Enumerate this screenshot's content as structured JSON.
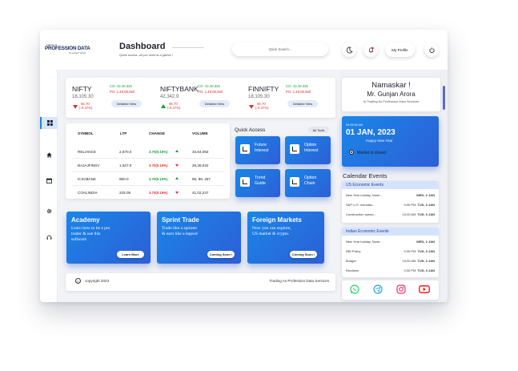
{
  "brand": {
    "logo_small": "trading as",
    "logo_main": "PROFESSION DATA",
    "logo_tag": "we analyze stocks"
  },
  "header": {
    "title": "Dashboard",
    "subtitle": "Quick access, all you need at a glance !",
    "search_placeholder": "Quick Search...",
    "profile_label": "My Profile"
  },
  "indices": [
    {
      "name": "NIFTY",
      "price": "18,105.30",
      "change": "65.70",
      "pct": "(-0.47%)",
      "co": "CO: 42,49,325",
      "po": "PO: 1,49,09,650",
      "direction": "down",
      "view": "Detailed View"
    },
    {
      "name": "NIFTYBANK",
      "price": "42,342.9",
      "change": "65.70",
      "pct": "(-0.47%)",
      "co": "CO: 42,49,325",
      "po": "PO: 1,49,09,650",
      "direction": "up",
      "view": "Detailed View"
    },
    {
      "name": "FINNIFTY",
      "price": "18,105.30",
      "change": "65.70",
      "pct": "(-0.47%)",
      "co": "CO: 42,49,325",
      "po": "PO: 1,49,09,650",
      "direction": "down",
      "view": "Detailed View"
    }
  ],
  "table": {
    "headers": [
      "SYMBOL",
      "LTP",
      "CHANGE",
      "VOLUME"
    ],
    "rows": [
      {
        "symbol": "RELIANCE",
        "ltp": "2,670.0",
        "change": "3.70(0.15%)",
        "dir": "up",
        "volume": "33,64,092"
      },
      {
        "symbol": "BAJAJFINSV",
        "ltp": "1,547.0",
        "change": "3.70(0.15%)",
        "dir": "down",
        "volume": "26,38,022"
      },
      {
        "symbol": "ICICIBANK",
        "ltp": "950.0",
        "change": "3.70(0.15%)",
        "dir": "up",
        "volume": "96, 88, 257"
      },
      {
        "symbol": "COALINDIA",
        "ltp": "225.05",
        "change": "3.70(0.15%)",
        "dir": "down",
        "volume": "41,02,247"
      }
    ]
  },
  "quick_access": {
    "title": "Quick Access",
    "all_tools": "All Tools",
    "tiles": [
      {
        "label1": "Future",
        "label2": "Interest"
      },
      {
        "label1": "Option",
        "label2": "Interest"
      },
      {
        "label1": "Trend",
        "label2": "Guide"
      },
      {
        "label1": "Option",
        "label2": "Chain"
      }
    ]
  },
  "promos": [
    {
      "title": "Academy",
      "text1": "Learn how to be a pro",
      "text2": "trader & use this",
      "text3": "software",
      "button": "Learn More"
    },
    {
      "title": "Sprint Trade",
      "text1": "Trade like a sprinter",
      "text2": "& earn like a legend",
      "text3": "",
      "button": "Coming Soon !"
    },
    {
      "title": "Foreign Markets",
      "text1": "Now you can explore,",
      "text2": "US market & crypto.",
      "text3": "",
      "button": "Coming Soon !"
    }
  ],
  "footer": {
    "copyright": "copyright 2023",
    "company": "Trading As Profession Data Services"
  },
  "greeting": {
    "hello": "Namaskar !",
    "name": "Mr. Gunjan Arora",
    "welcome": "to Trading As Profession Data Services"
  },
  "date_card": {
    "time": "09:05:55 AM",
    "date": "01 JAN, 2023",
    "note": "Happy New Year",
    "status": "Market is closed"
  },
  "calendar": {
    "title": "Calendar Events",
    "us": {
      "title": "US Economic Events",
      "events": [
        {
          "name": "New Year holiday, None...",
          "time": "",
          "day": "WED, 2 JAN"
        },
        {
          "name": "S&P U.S. manufac...",
          "time": "9:30 PM",
          "day": "TUS, 3 JAN"
        },
        {
          "name": "Construction spend...",
          "time": "10:00 AM",
          "day": "TUS, 3 JAN"
        }
      ]
    },
    "india": {
      "title": "Indian Economic Events",
      "events": [
        {
          "name": "New Year holiday, None...",
          "time": "",
          "day": "WED, 2 JAN"
        },
        {
          "name": "RBI Policy",
          "time": "9:30 PM",
          "day": "TUS, 3 JAN"
        },
        {
          "name": "Budget",
          "time": "10:00 AM",
          "day": "TUS, 3 JAN"
        },
        {
          "name": "Elections",
          "time": "9:30 PM",
          "day": "TUS, 3 JAN"
        }
      ]
    }
  },
  "colors": {
    "accent": "#1a86e8",
    "up": "#1c9a3a",
    "down": "#e0302f",
    "whatsapp": "#25d366",
    "telegram": "#2aa3de",
    "instagram": "#e1306c",
    "youtube": "#ff0000"
  }
}
